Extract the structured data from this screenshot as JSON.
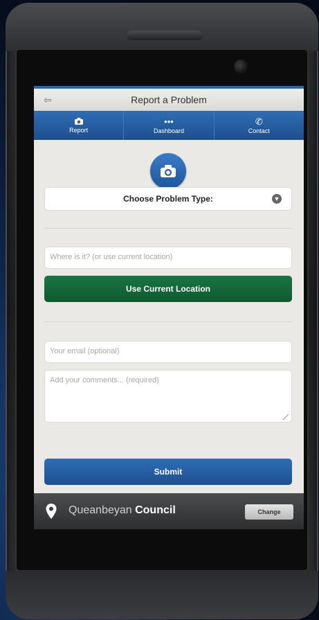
{
  "header": {
    "back_icon": "back-arrow-icon",
    "title": "Report a Problem"
  },
  "tabs": [
    {
      "label": "Report",
      "icon": "camera-icon"
    },
    {
      "label": "Dashboard",
      "icon": "dots-icon"
    },
    {
      "label": "Contact",
      "icon": "phone-icon"
    }
  ],
  "form": {
    "camera_icon": "camera-icon",
    "problem_type": "Choose Problem Type:",
    "location_placeholder": "Where is it? (or use current location)",
    "use_location_label": "Use Current Location",
    "email_placeholder": "Your email (optional)",
    "comments_placeholder": "Add your comments... (required)",
    "submit_label": "Submit"
  },
  "footer": {
    "council_name": "Queanbeyan",
    "council_suffix": "Council",
    "change_label": "Change"
  },
  "colors": {
    "accent_blue": "#2f6db5",
    "green": "#1a7442",
    "screen_bg": "#ebe9e5"
  }
}
